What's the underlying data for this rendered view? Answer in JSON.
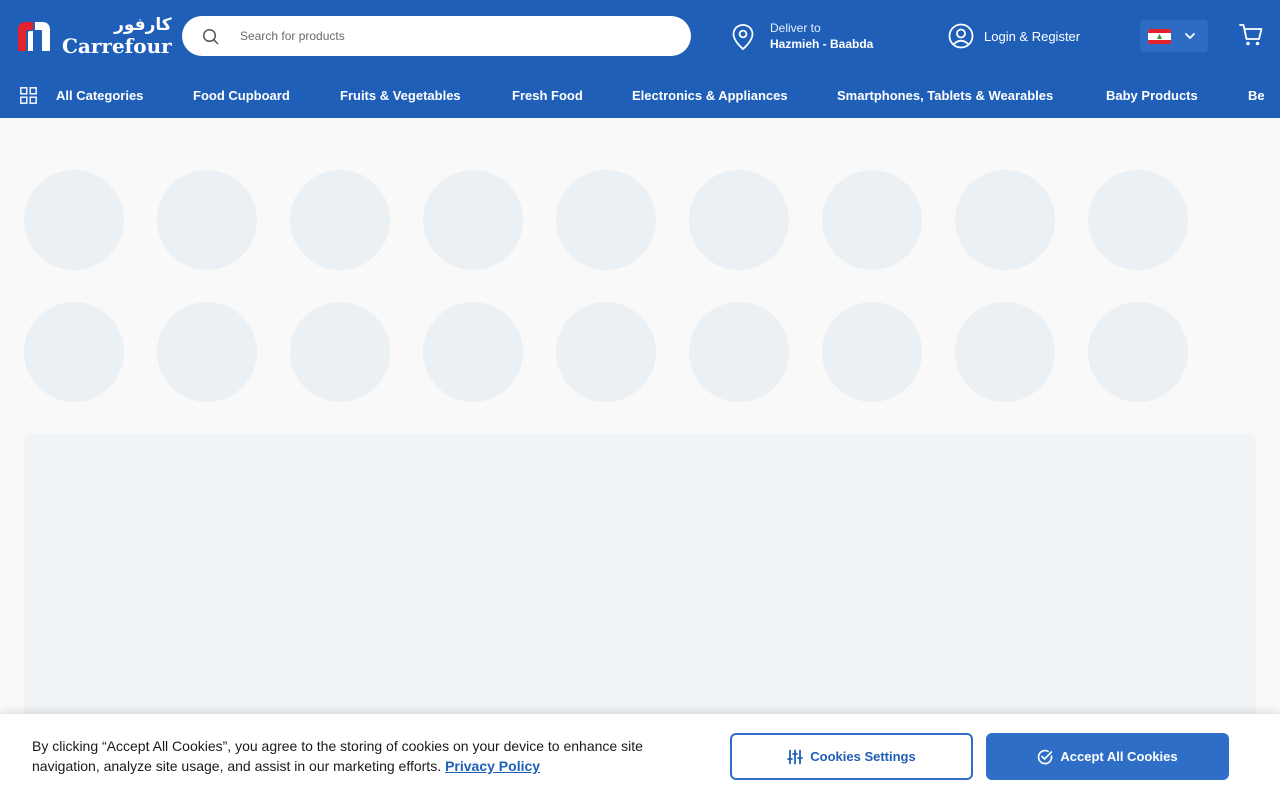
{
  "header": {
    "logo_ar": "كارفور",
    "logo_en": "Carrefour",
    "search_placeholder": "Search for products",
    "deliver_label": "Deliver to",
    "deliver_location": "Hazmieh - Baabda",
    "login_label": "Login & Register",
    "country_flag": "lebanon-flag-icon",
    "cart_icon": "cart-icon"
  },
  "nav": {
    "all_categories": "All Categories",
    "items": [
      "Food Cupboard",
      "Fruits & Vegetables",
      "Fresh Food",
      "Electronics & Appliances",
      "Smartphones, Tablets & Wearables",
      "Baby Products",
      "Be"
    ]
  },
  "cookie": {
    "text": "By clicking “Accept All Cookies”, you agree to the storing of cookies on your device to enhance site navigation, analyze site usage, and assist in our marketing efforts.",
    "privacy_link": "Privacy Policy",
    "settings_label": "Cookies Settings",
    "accept_label": "Accept All Cookies"
  },
  "colors": {
    "brand_blue": "#1f5fb8",
    "button_blue": "#2f6ec6",
    "skeleton": "#eaf0f3"
  }
}
